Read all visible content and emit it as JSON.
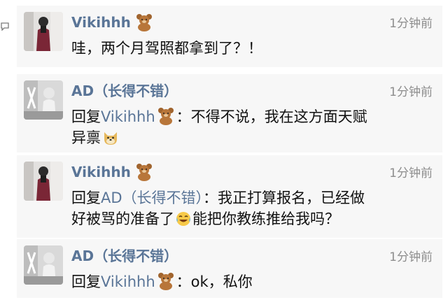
{
  "comments": [
    {
      "author": "Vikihhh",
      "author_emoji": "bear-emoji",
      "time": "1分钟前",
      "text": "哇，两个月驾照都拿到了？！"
    },
    {
      "author": "AD（长得不错）",
      "time": "1分钟前",
      "reply_prefix": "回复",
      "reply_to": "Vikihhh",
      "reply_to_emoji": "bear-emoji",
      "reply_colon": "：",
      "text_line1": "不得不说，我在这方面天赋",
      "text_line2": "异禀",
      "trailing_emoji": "doge-emoji"
    },
    {
      "author": "Vikihhh",
      "author_emoji": "bear-emoji",
      "time": "1分钟前",
      "reply_prefix": "回复",
      "reply_to": "AD（长得不错）",
      "reply_colon": "：",
      "text_line1": "我正打算报名，已经做",
      "text_line2a": "好被骂的准备了",
      "middle_emoji": "tears-of-joy-emoji",
      "text_line2b": "能把你教练推给我吗？"
    },
    {
      "author": "AD（长得不错）",
      "time": "1分钟前",
      "reply_prefix": "回复",
      "reply_to": "Vikihhh",
      "reply_to_emoji": "bear-emoji",
      "reply_colon": "：",
      "text": "ok，私你"
    }
  ],
  "colors": {
    "name": "#5a7597",
    "time": "#8d8d8d",
    "card_bg": "#f7f7f7",
    "text": "#111111"
  }
}
